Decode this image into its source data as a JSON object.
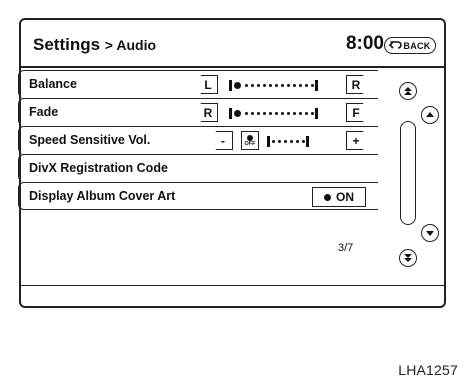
{
  "header": {
    "title": "Settings",
    "separator": ">",
    "crumb": "Audio",
    "clock": "8:00",
    "back_label": "BACK"
  },
  "rows": [
    {
      "label": "Balance",
      "left_btn": "L",
      "right_btn": "R"
    },
    {
      "label": "Fade",
      "left_btn": "R",
      "right_btn": "F"
    },
    {
      "label": "Speed Sensitive Vol.",
      "minus_btn": "-",
      "off_label": "OFF",
      "plus_btn": "+"
    },
    {
      "label": "DivX Registration Code"
    },
    {
      "label": "Display Album Cover Art",
      "toggle_label": "ON"
    }
  ],
  "pagination": {
    "text": "3/7"
  },
  "figure_code": "LHA1257"
}
